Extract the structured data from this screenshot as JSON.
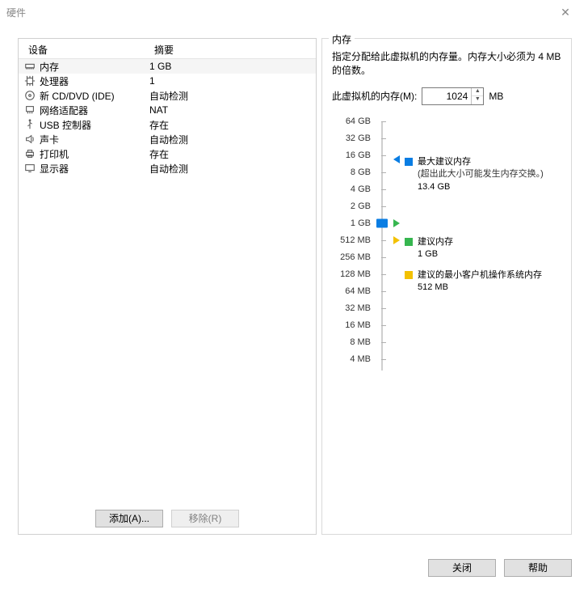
{
  "window": {
    "title": "硬件",
    "close_symbol": "✕"
  },
  "columns": {
    "device": "设备",
    "summary": "摘要"
  },
  "devices": [
    {
      "icon": "memory-icon",
      "name": "内存",
      "summary": "1 GB",
      "selected": true
    },
    {
      "icon": "cpu-icon",
      "name": "处理器",
      "summary": "1"
    },
    {
      "icon": "cd-icon",
      "name": "新 CD/DVD (IDE)",
      "summary": "自动检测"
    },
    {
      "icon": "network-icon",
      "name": "网络适配器",
      "summary": "NAT"
    },
    {
      "icon": "usb-icon",
      "name": "USB 控制器",
      "summary": "存在"
    },
    {
      "icon": "sound-icon",
      "name": "声卡",
      "summary": "自动检测"
    },
    {
      "icon": "printer-icon",
      "name": "打印机",
      "summary": "存在"
    },
    {
      "icon": "display-icon",
      "name": "显示器",
      "summary": "自动检测"
    }
  ],
  "leftButtons": {
    "add": "添加(A)...",
    "remove": "移除(R)"
  },
  "memoryBox": {
    "legend": "内存",
    "desc": "指定分配给此虚拟机的内存量。内存大小必须为 4 MB 的倍数。",
    "inputLabel": "此虚拟机的内存(M):",
    "value": "1024",
    "unit": "MB",
    "ticks": [
      "64 GB",
      "32 GB",
      "16 GB",
      "8 GB",
      "4 GB",
      "2 GB",
      "1 GB",
      "512 MB",
      "256 MB",
      "128 MB",
      "64 MB",
      "32 MB",
      "16 MB",
      "8 MB",
      "4 MB"
    ],
    "legendItems": {
      "max": {
        "title": "最大建议内存",
        "note": "(超出此大小可能发生内存交换。)",
        "value": "13.4 GB"
      },
      "rec": {
        "title": "建议内存",
        "value": "1 GB"
      },
      "minos": {
        "title": "建议的最小客户机操作系统内存",
        "value": "512 MB"
      }
    }
  },
  "bottom": {
    "close": "关闭",
    "help": "帮助"
  },
  "colors": {
    "blue": "#0a7de3",
    "green": "#36b64f",
    "yellow": "#f3c100"
  }
}
